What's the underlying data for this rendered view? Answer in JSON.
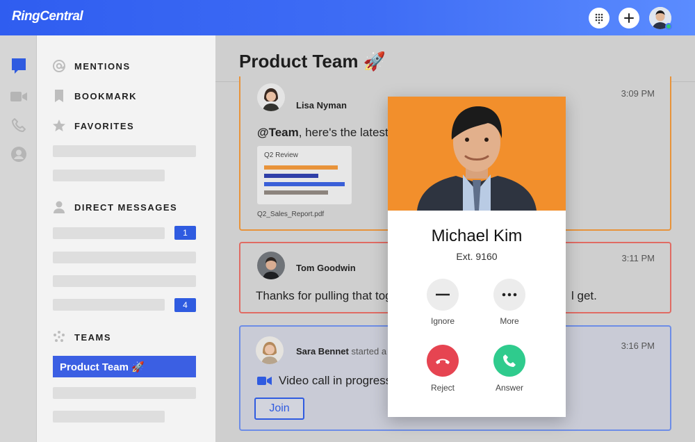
{
  "app": {
    "logo": "RingCentral"
  },
  "sidebar": {
    "nav": [
      {
        "label": "MENTIONS",
        "icon": "at-icon"
      },
      {
        "label": "BOOKMARK",
        "icon": "bookmark-icon"
      },
      {
        "label": "FAVORITES",
        "icon": "star-icon"
      }
    ],
    "direct_messages": {
      "label": "DIRECT MESSAGES",
      "badges": [
        "1",
        "4"
      ]
    },
    "teams": {
      "label": "TEAMS",
      "active": "Product Team 🚀"
    }
  },
  "main": {
    "title": "Product Team 🚀",
    "messages": [
      {
        "sender": "Lisa Nyman",
        "time": "3:09 PM",
        "mention": "@Team",
        "text": ", here's the latest",
        "attachment": {
          "title": "Q2 Review",
          "filename": "Q2_Sales_Report.pdf"
        }
      },
      {
        "sender": "Tom Goodwin",
        "time": "3:11 PM",
        "text_left": "Thanks for pulling that tog",
        "text_right": "l get."
      },
      {
        "sender": "Sara Bennet",
        "sender_suffix": "started a",
        "time": "3:16 PM",
        "text": "Video call in progress",
        "join_label": "Join"
      }
    ]
  },
  "call": {
    "name": "Michael Kim",
    "ext": "Ext. 9160",
    "ignore_label": "Ignore",
    "more_label": "More",
    "reject_label": "Reject",
    "answer_label": "Answer"
  },
  "colors": {
    "brand": "#3b63f0",
    "reject": "#e64451",
    "answer": "#2fcb8d",
    "accent_orange": "#f28f2c"
  }
}
